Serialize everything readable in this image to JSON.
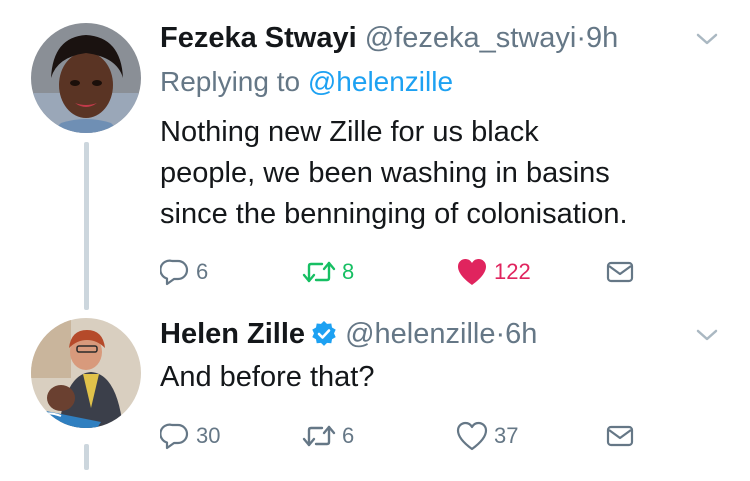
{
  "tweets": [
    {
      "name": "Fezeka Stwayi",
      "handle": "@fezeka_stwayi",
      "separator": "·",
      "time": "9h",
      "replying_prefix": "Replying to",
      "replying_handle": "@helenzille",
      "text_lines": [
        "Nothing new Zille for us black",
        "people, we been washing in basins",
        "since the benninging of colonisation."
      ],
      "replies": "6",
      "retweets": "8",
      "likes": "122",
      "retweeted": true,
      "liked": true
    },
    {
      "name": "Helen Zille",
      "verified": true,
      "handle": "@helenzille",
      "separator": "·",
      "time": "6h",
      "text": "And before that?",
      "replies": "30",
      "retweets": "6",
      "likes": "37",
      "retweeted": false,
      "liked": false
    }
  ],
  "icons": {
    "reply": "reply-icon",
    "retweet": "retweet-icon",
    "like": "heart-icon",
    "dm": "envelope-icon",
    "more": "chevron-down-icon",
    "verified": "verified-badge-icon"
  },
  "colors": {
    "text": "#14171a",
    "muted": "#657786",
    "link": "#1da1f2",
    "retweet_active": "#17bf63",
    "like_active": "#e0245e",
    "verified": "#1da1f2"
  }
}
